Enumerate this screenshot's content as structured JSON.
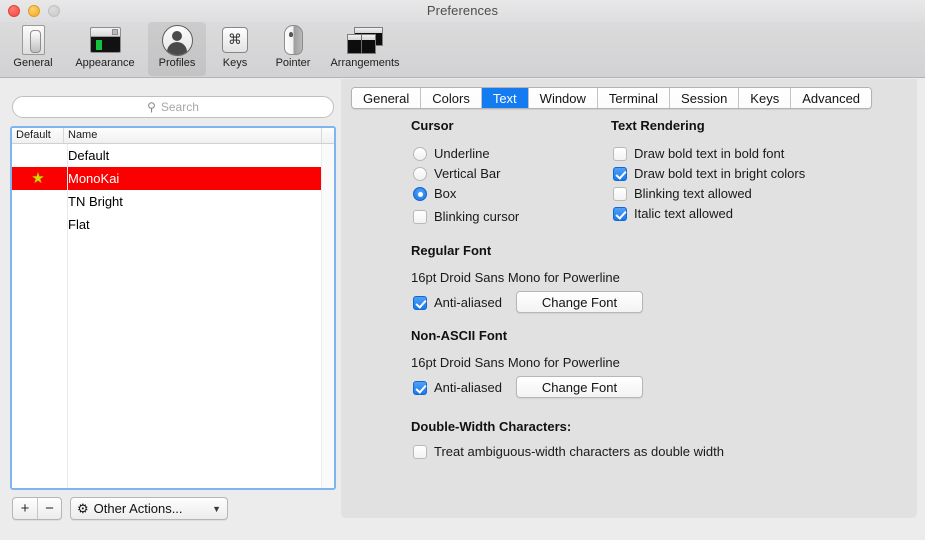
{
  "window": {
    "title": "Preferences",
    "traffic_lights": [
      "close",
      "minimize",
      "zoom"
    ]
  },
  "toolbar": {
    "items": [
      {
        "label": "General",
        "icon": "switch-icon",
        "selected": false
      },
      {
        "label": "Appearance",
        "icon": "window-appearance-icon",
        "selected": false
      },
      {
        "label": "Profiles",
        "icon": "person-icon",
        "selected": true
      },
      {
        "label": "Keys",
        "icon": "command-key-icon",
        "selected": false
      },
      {
        "label": "Pointer",
        "icon": "mouse-icon",
        "selected": false
      },
      {
        "label": "Arrangements",
        "icon": "windows-stack-icon",
        "selected": false
      }
    ]
  },
  "sidebar": {
    "search": {
      "placeholder": "Search",
      "value": "",
      "icon": "search-icon"
    },
    "columns": [
      "Default",
      "Name"
    ],
    "profiles": [
      {
        "name": "Default",
        "default": false,
        "selected": false
      },
      {
        "name": "MonoKai",
        "default": true,
        "selected": true
      },
      {
        "name": "TN Bright",
        "default": false,
        "selected": false
      },
      {
        "name": "Flat",
        "default": false,
        "selected": false
      }
    ],
    "star_glyph": "★",
    "selection_color": "#fb0000",
    "star_color": "#d7d700",
    "footer": {
      "add_label": "+",
      "remove_label": "−",
      "other_actions_label": "Other Actions...",
      "gear_icon": "gear-icon",
      "chevron_icon": "chevron-down-icon"
    }
  },
  "main": {
    "tabs": [
      {
        "label": "General",
        "active": false
      },
      {
        "label": "Colors",
        "active": false
      },
      {
        "label": "Text",
        "active": true
      },
      {
        "label": "Window",
        "active": false
      },
      {
        "label": "Terminal",
        "active": false
      },
      {
        "label": "Session",
        "active": false
      },
      {
        "label": "Keys",
        "active": false
      },
      {
        "label": "Advanced",
        "active": false
      }
    ],
    "active_tab_color": "#147cf0",
    "cursor": {
      "title": "Cursor",
      "options": [
        {
          "label": "Underline",
          "checked": false
        },
        {
          "label": "Vertical Bar",
          "checked": false
        },
        {
          "label": "Box",
          "checked": true
        }
      ],
      "blinking": {
        "label": "Blinking cursor",
        "checked": false
      }
    },
    "text_rendering": {
      "title": "Text Rendering",
      "options": [
        {
          "label": "Draw bold text in bold font",
          "checked": false
        },
        {
          "label": "Draw bold text in bright colors",
          "checked": true
        },
        {
          "label": "Blinking text allowed",
          "checked": false
        },
        {
          "label": "Italic text allowed",
          "checked": true
        }
      ]
    },
    "regular_font": {
      "title": "Regular Font",
      "value": "16pt Droid Sans Mono for Powerline",
      "antialiased": {
        "label": "Anti-aliased",
        "checked": true
      },
      "change_label": "Change Font"
    },
    "non_ascii_font": {
      "title": "Non-ASCII Font",
      "value": "16pt Droid Sans Mono for Powerline",
      "antialiased": {
        "label": "Anti-aliased",
        "checked": true
      },
      "change_label": "Change Font"
    },
    "double_width": {
      "title": "Double-Width Characters:",
      "option": {
        "label": "Treat ambiguous-width characters as double width",
        "checked": false
      }
    }
  }
}
